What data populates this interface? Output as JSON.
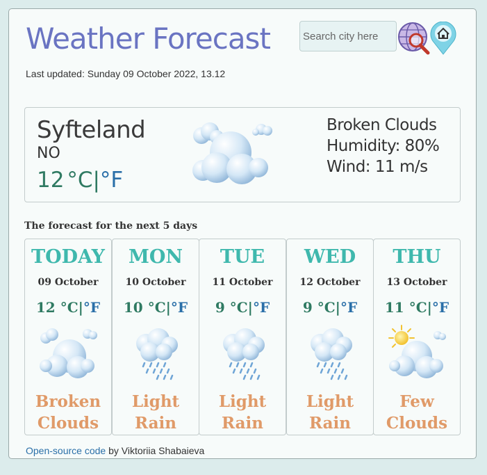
{
  "header": {
    "title": "Weather Forecast",
    "last_updated": "Last updated: Sunday 09 October 2022, 13.12",
    "search_placeholder": "Search city here"
  },
  "current": {
    "city": "Syfteland",
    "country": "NO",
    "temp_value": "12",
    "unit_c": "°C",
    "unit_sep": "|",
    "unit_f": "°F",
    "description": "Broken Clouds",
    "humidity": "Humidity: 80%",
    "wind": "Wind: 11 m/s",
    "icon": "broken-clouds-icon"
  },
  "forecast": {
    "title": "The forecast for the next 5 days",
    "days": [
      {
        "name": "TODAY",
        "date": "09 October",
        "temp": "12",
        "desc1": "Broken",
        "desc2": "Clouds",
        "icon": "broken-clouds-icon"
      },
      {
        "name": "MON",
        "date": "10 October",
        "temp": "10",
        "desc1": "Light",
        "desc2": "Rain",
        "icon": "light-rain-icon"
      },
      {
        "name": "TUE",
        "date": "11 October",
        "temp": "9",
        "desc1": "Light",
        "desc2": "Rain",
        "icon": "light-rain-icon"
      },
      {
        "name": "WED",
        "date": "12 October",
        "temp": "9",
        "desc1": "Light",
        "desc2": "Rain",
        "icon": "light-rain-icon"
      },
      {
        "name": "THU",
        "date": "13 October",
        "temp": "11",
        "desc1": "Few",
        "desc2": "Clouds",
        "icon": "few-clouds-icon"
      }
    ]
  },
  "footer": {
    "link_text": "Open-source code",
    "rest": " by Viktoriia Shabaieva"
  },
  "colors": {
    "title": "#6a74c2",
    "day_name": "#3fb8ad",
    "description": "#e09a68",
    "celsius": "#2f7a62",
    "fahrenheit": "#2a6fa8"
  }
}
